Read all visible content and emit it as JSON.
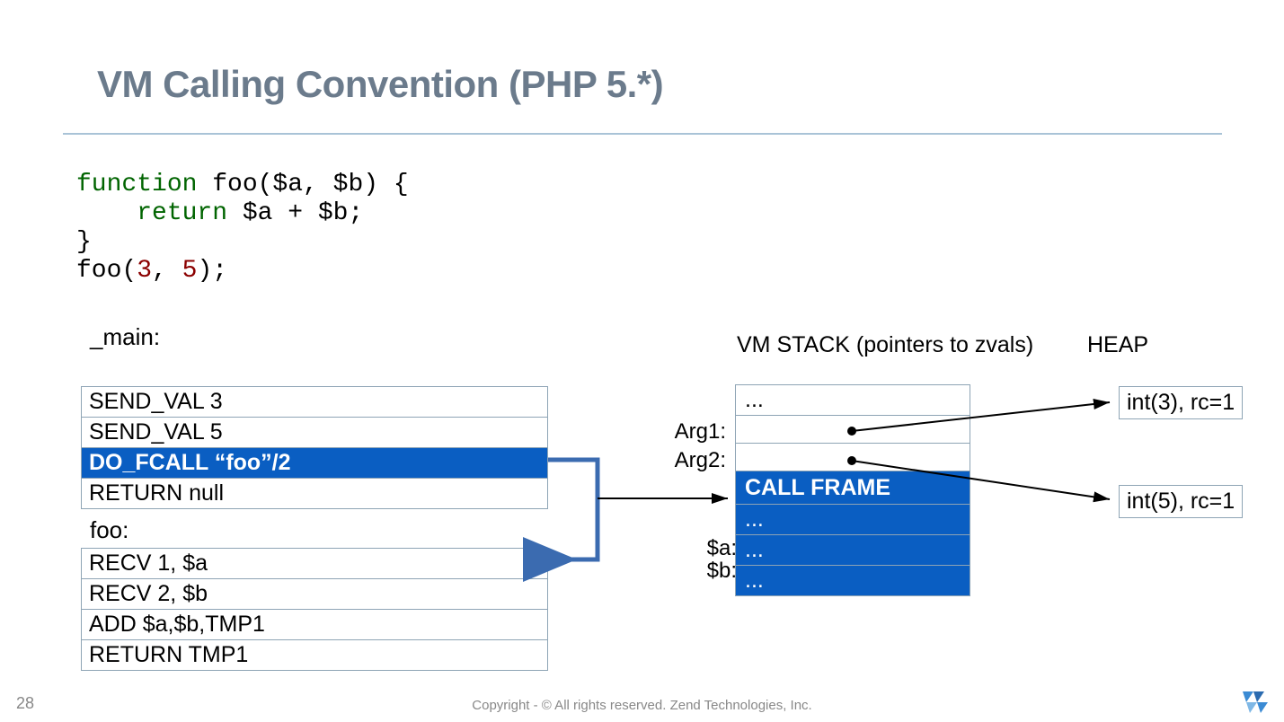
{
  "title": "VM Calling Convention (PHP 5.*)",
  "code": {
    "l1a": "function",
    "l1b": " foo($a, $b) {",
    "l2a": "    return",
    "l2b": " $a + $b;",
    "l3": "}",
    "l4a": "foo(",
    "l4b": "3",
    "l4c": ", ",
    "l4d": "5",
    "l4e": ");"
  },
  "labels": {
    "main": "_main:",
    "foo": "foo:",
    "stack": "VM STACK (pointers to zvals)",
    "heap": "HEAP",
    "arg1": "Arg1:",
    "arg2": "Arg2:",
    "a": "$a:",
    "b": "$b:"
  },
  "main_ops": [
    {
      "t": "SEND_VAL 3",
      "hl": false
    },
    {
      "t": "SEND_VAL 5",
      "hl": false
    },
    {
      "t": "DO_FCALL  “foo”/2",
      "hl": true
    },
    {
      "t": "RETURN null",
      "hl": false
    }
  ],
  "foo_ops": [
    {
      "t": "RECV 1, $a"
    },
    {
      "t": "RECV 2, $b"
    },
    {
      "t": "ADD $a,$b,TMP1"
    },
    {
      "t": "RETURN TMP1"
    }
  ],
  "stack_rows": [
    {
      "t": "...",
      "cls": ""
    },
    {
      "t": " ",
      "cls": ""
    },
    {
      "t": " ",
      "cls": ""
    },
    {
      "t": "CALL FRAME",
      "cls": "cf"
    },
    {
      "t": "...",
      "cls": "blue"
    },
    {
      "t": "...",
      "cls": "blue"
    },
    {
      "t": "...",
      "cls": "blue"
    }
  ],
  "heap": {
    "h1": "int(3), rc=1",
    "h2": "int(5), rc=1"
  },
  "footer": {
    "page": "28",
    "copyright": "Copyright - © All rights reserved. Zend Technologies, Inc."
  }
}
